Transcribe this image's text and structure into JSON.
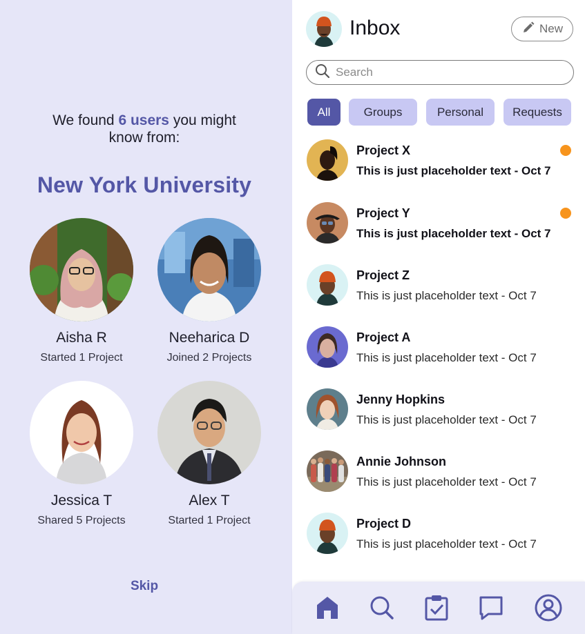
{
  "onboarding": {
    "found_prefix": "We found ",
    "found_count": "6 users",
    "found_suffix": " you might",
    "found_line2": "know from:",
    "university": "New York University",
    "users": [
      {
        "name": "Aisha R",
        "sub": "Started 1 Project"
      },
      {
        "name": "Neeharica D",
        "sub": "Joined 2 Projects"
      },
      {
        "name": "Jessica T",
        "sub": "Shared 5 Projects"
      },
      {
        "name": "Alex T",
        "sub": "Started 1 Project"
      }
    ],
    "skip_label": "Skip"
  },
  "inbox": {
    "title": "Inbox",
    "new_label": "New",
    "search_placeholder": "Search",
    "tabs": [
      "All",
      "Groups",
      "Personal",
      "Requests"
    ],
    "active_tab": "All",
    "conversations": [
      {
        "name": "Project X",
        "message": "This is just placeholder text - Oct 7",
        "unread": true
      },
      {
        "name": "Project Y",
        "message": "This is just placeholder text - Oct 7",
        "unread": true
      },
      {
        "name": "Project Z",
        "message": "This is just placeholder text - Oct 7",
        "unread": false
      },
      {
        "name": "Project A",
        "message": "This is just placeholder text - Oct 7",
        "unread": false
      },
      {
        "name": "Jenny Hopkins",
        "message": "This is just placeholder text - Oct 7",
        "unread": false
      },
      {
        "name": "Annie Johnson",
        "message": "This is just placeholder text - Oct 7",
        "unread": false
      },
      {
        "name": "Project D",
        "message": "This is just placeholder text - Oct 7",
        "unread": false
      }
    ]
  },
  "bottom_nav": {
    "items": [
      "home-icon",
      "search-icon",
      "tasks-icon",
      "chat-icon",
      "profile-icon"
    ]
  },
  "colors": {
    "accent": "#5457a6",
    "tab_inactive": "#c8c8f3",
    "left_bg": "#e6e6f8",
    "unread_dot": "#f7941d"
  }
}
